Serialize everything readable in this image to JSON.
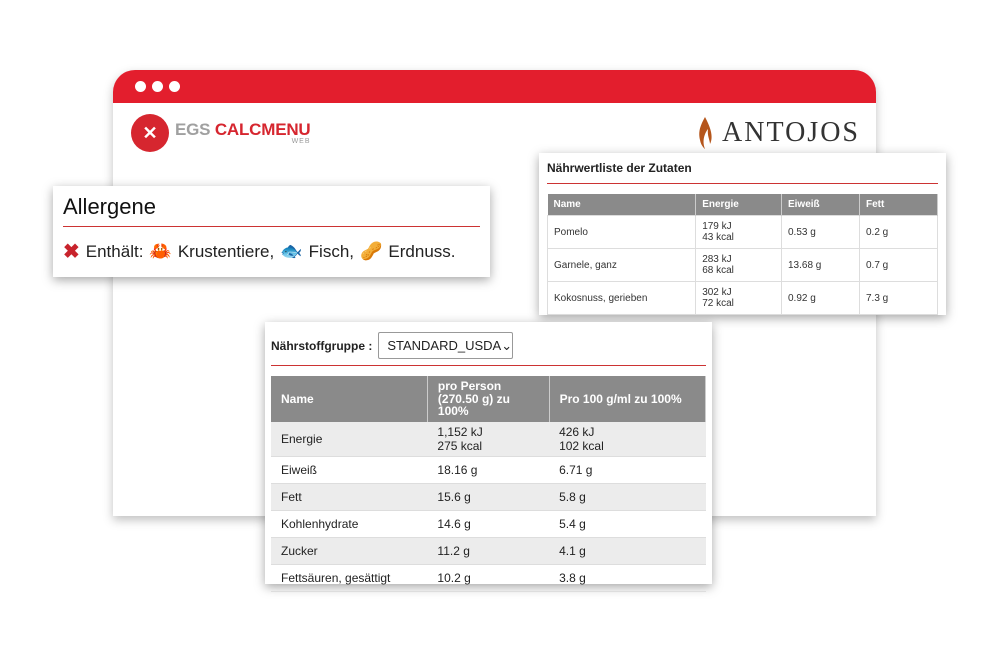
{
  "browser": {
    "accent": "#e31e2d"
  },
  "logos": {
    "left_main_1": "EGS",
    "left_main_2": "CALCMENU",
    "left_sub": "WEB",
    "right": "ANTOJOS"
  },
  "allergens": {
    "title": "Allergene",
    "prefix": "Enthält:",
    "items": [
      {
        "icon": "crab-icon",
        "label": "Krustentiere,"
      },
      {
        "icon": "fish-icon",
        "label": "Fisch,"
      },
      {
        "icon": "peanut-icon",
        "label": "Erdnuss."
      }
    ]
  },
  "ingredient_list": {
    "title": "Nährwertliste der Zutaten",
    "headers": [
      "Name",
      "Energie",
      "Eiweiß",
      "Fett"
    ],
    "rows": [
      {
        "name": "Pomelo",
        "kj": "179 kJ",
        "kcal": "43 kcal",
        "protein": "0.53 g",
        "fat": "0.2 g"
      },
      {
        "name": "Garnele, ganz",
        "kj": "283 kJ",
        "kcal": "68 kcal",
        "protein": "13.68 g",
        "fat": "0.7 g"
      },
      {
        "name": "Kokosnuss, gerieben",
        "kj": "302 kJ",
        "kcal": "72 kcal",
        "protein": "0.92 g",
        "fat": "7.3 g"
      }
    ]
  },
  "nutrients": {
    "group_label": "Nährstoffgruppe :",
    "group_value": "STANDARD_USDA",
    "headers": [
      "Name",
      "pro Person (270.50 g) zu 100%",
      "Pro 100 g/ml zu 100%"
    ],
    "rows": [
      {
        "name": "Energie",
        "per_person": "1,152 kJ",
        "per_person_2": "275 kcal",
        "per_100": "426 kJ",
        "per_100_2": "102 kcal"
      },
      {
        "name": "Eiweiß",
        "per_person": "18.16 g",
        "per_person_2": "",
        "per_100": "6.71 g",
        "per_100_2": ""
      },
      {
        "name": "Fett",
        "per_person": "15.6 g",
        "per_person_2": "",
        "per_100": "5.8 g",
        "per_100_2": ""
      },
      {
        "name": "Kohlenhydrate",
        "per_person": "14.6 g",
        "per_person_2": "",
        "per_100": "5.4 g",
        "per_100_2": ""
      },
      {
        "name": "Zucker",
        "per_person": "11.2 g",
        "per_person_2": "",
        "per_100": "4.1 g",
        "per_100_2": ""
      },
      {
        "name": "Fettsäuren, gesättigt",
        "per_person": "10.2 g",
        "per_person_2": "",
        "per_100": "3.8 g",
        "per_100_2": ""
      }
    ]
  }
}
